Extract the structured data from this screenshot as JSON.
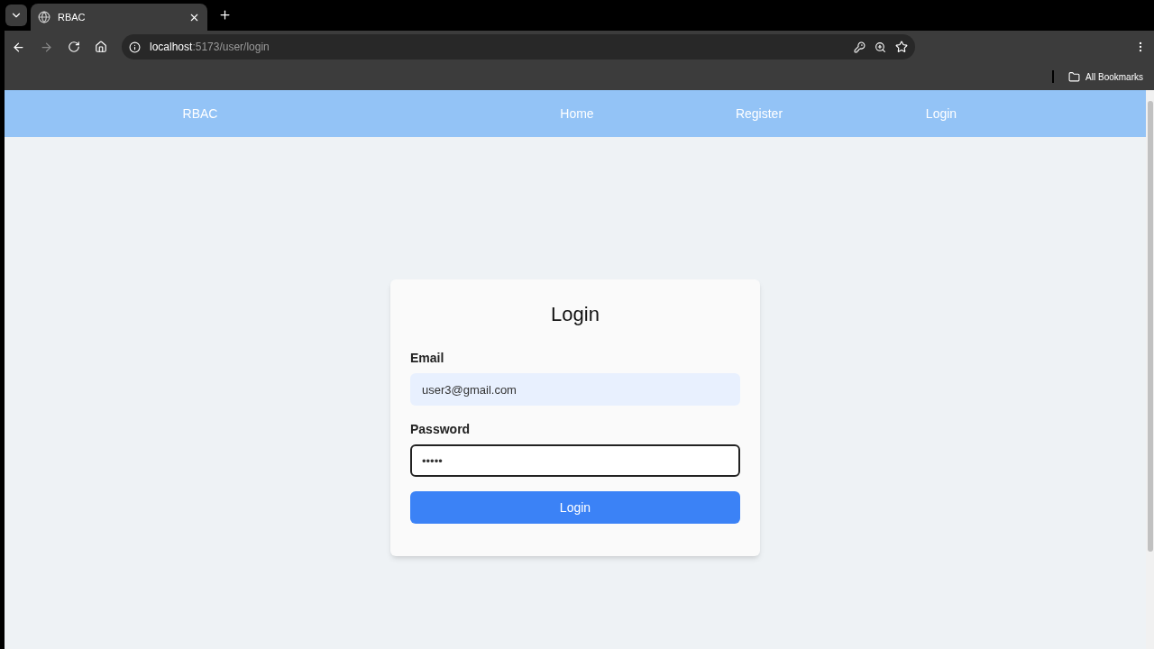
{
  "browser": {
    "tab": {
      "title": "RBAC",
      "selected": true
    },
    "address": {
      "host": "localhost",
      "path": ":5173/user/login"
    },
    "bookmarks": {
      "label": "All Bookmarks"
    }
  },
  "navbar": {
    "brand": "RBAC",
    "links": [
      "Home",
      "Register",
      "Login"
    ]
  },
  "form": {
    "title": "Login",
    "fields": [
      {
        "kind": "email",
        "label": "Email",
        "value": "user3@gmail.com",
        "focused": false
      },
      {
        "kind": "password",
        "label": "Password",
        "value": "•••••",
        "focused": true
      }
    ],
    "submit": "Login"
  }
}
